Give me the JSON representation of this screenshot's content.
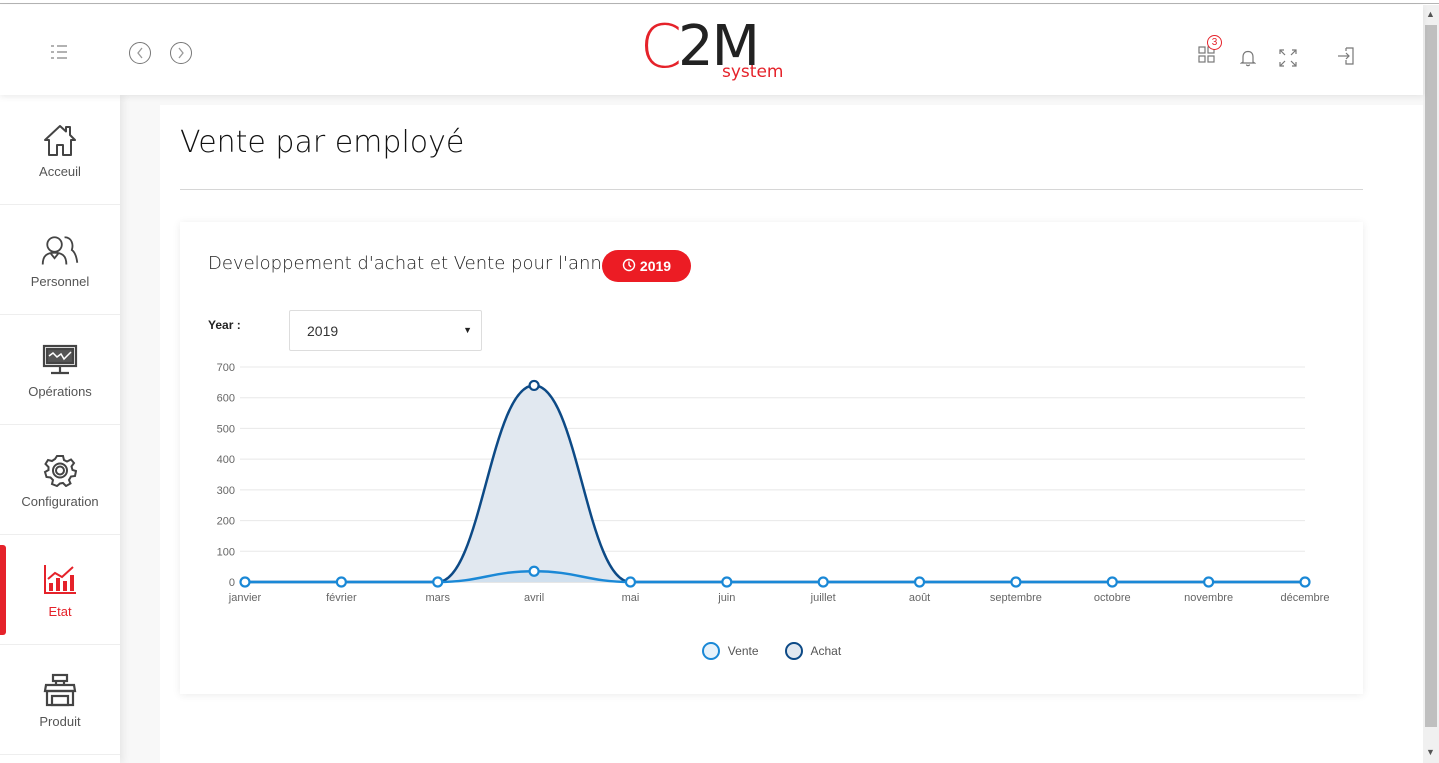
{
  "header": {
    "logo": {
      "c": "C",
      "rest": "2M",
      "sub": "system"
    },
    "notification_count": "3",
    "icons": [
      "menu-icon",
      "back-icon",
      "forward-icon",
      "apps-icon",
      "bell-icon",
      "fullscreen-icon",
      "logout-icon"
    ]
  },
  "sidebar": {
    "items": [
      {
        "label": "Acceuil",
        "icon": "home-icon",
        "active": false
      },
      {
        "label": "Personnel",
        "icon": "users-icon",
        "active": false
      },
      {
        "label": "Opérations",
        "icon": "monitor-icon",
        "active": false
      },
      {
        "label": "Configuration",
        "icon": "gear-icon",
        "active": false
      },
      {
        "label": "Etat",
        "icon": "chart-icon",
        "active": true
      },
      {
        "label": "Produit",
        "icon": "shop-icon",
        "active": false
      }
    ]
  },
  "page": {
    "title": "Vente par employé"
  },
  "card": {
    "title": "Developpement d'achat et Vente pour l'annee",
    "year_badge": "2019",
    "year_label": "Year :",
    "year_select_value": "2019"
  },
  "colors": {
    "accent": "#ec1c24",
    "vente": "#1a88d6",
    "achat": "#0d4a86",
    "achat_fill": "#e1e8f0"
  },
  "chart_data": {
    "type": "line",
    "title": "",
    "xlabel": "",
    "ylabel": "",
    "categories": [
      "janvier",
      "février",
      "mars",
      "avril",
      "mai",
      "juin",
      "juillet",
      "août",
      "septembre",
      "octobre",
      "novembre",
      "décembre"
    ],
    "series": [
      {
        "name": "Vente",
        "values": [
          0,
          0,
          0,
          35,
          0,
          0,
          0,
          0,
          0,
          0,
          0,
          0
        ]
      },
      {
        "name": "Achat",
        "values": [
          0,
          0,
          0,
          640,
          0,
          0,
          0,
          0,
          0,
          0,
          0,
          0
        ]
      }
    ],
    "ylim": [
      0,
      700
    ],
    "yticks": [
      0,
      100,
      200,
      300,
      400,
      500,
      600,
      700
    ],
    "grid": true,
    "legend": "bottom"
  }
}
